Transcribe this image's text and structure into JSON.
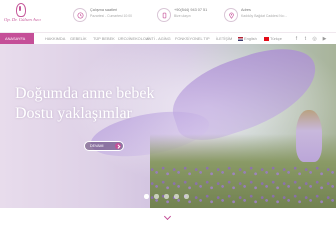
{
  "brand": {
    "name": "Op. Dr. Gülsen Avcı",
    "color": "#c54f98"
  },
  "contact": {
    "work_hours_title": "Çalışma saatleri",
    "work_hours_value": "Pazartesi - Cumartesi 10:00",
    "phone_title": "+90(544) 943 07 51",
    "phone_value": "Bize ulaşın",
    "address_title": "Adres",
    "address_value": "Kadıköy Bağdat Caddesi No:..."
  },
  "nav": {
    "items": [
      "ANASAYFA",
      "HAKKIMDA",
      "GEBELİK",
      "TÜP BEBEK",
      "ÜROJİNEKOLOJİ",
      "ANTİ - AGİNG",
      "FONKSİYONEL TIP",
      "İLETİŞİM"
    ],
    "lang_en": "English",
    "lang_tr": "Türkçe",
    "social_icons": [
      "facebook-icon",
      "twitter-icon",
      "instagram-icon",
      "youtube-icon"
    ]
  },
  "hero": {
    "line1": "Doğumda anne bebek",
    "line2": "Dostu yaklaşımlar",
    "button": "DEVAMI"
  }
}
